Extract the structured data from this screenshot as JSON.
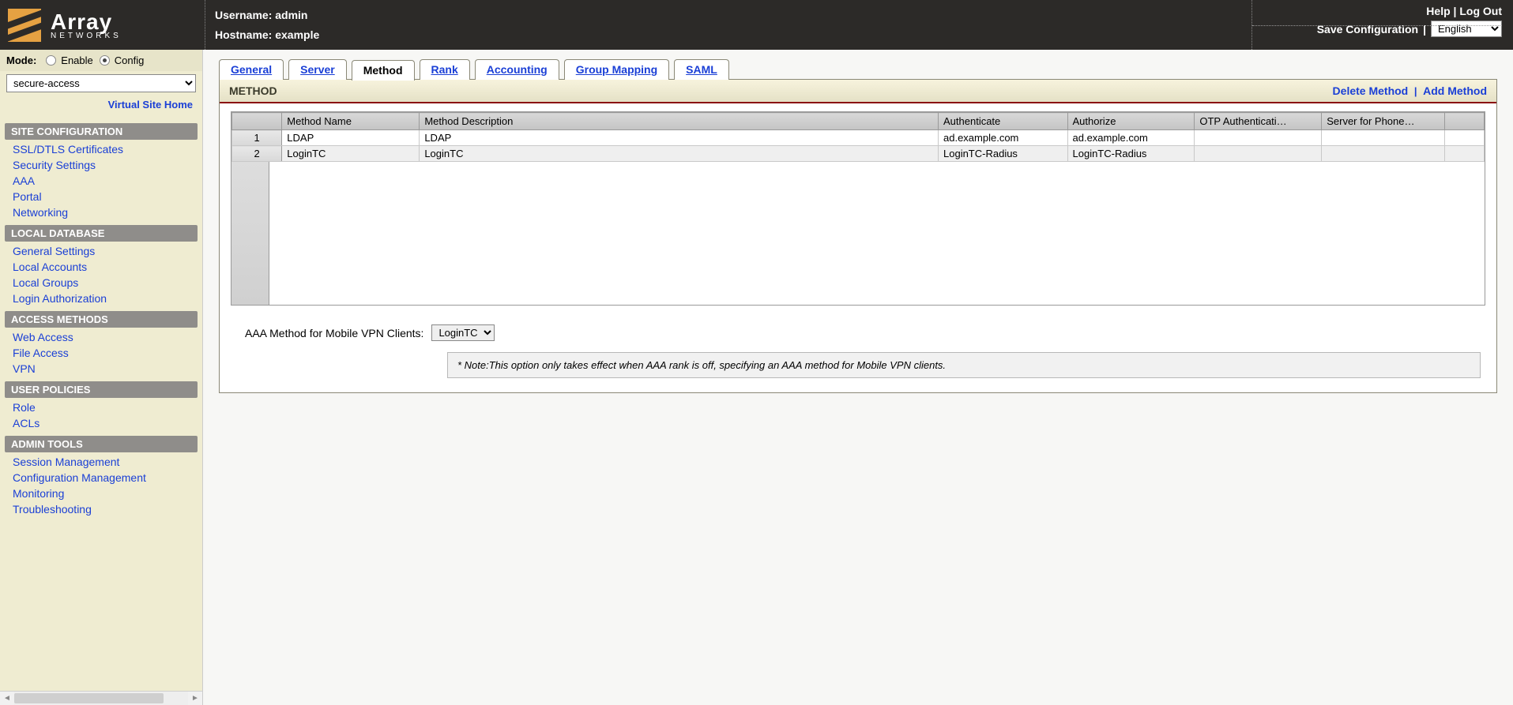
{
  "header": {
    "username_label": "Username: admin",
    "hostname_label": "Hostname: example",
    "help": "Help",
    "logout": "Log Out",
    "save_config": "Save Configuration",
    "language_selected": "English",
    "logo_big": "Array",
    "logo_small": "NETWORKS"
  },
  "sidebar": {
    "mode_label": "Mode:",
    "mode_enable": "Enable",
    "mode_config": "Config",
    "virtual_site_selected": "secure-access",
    "virtual_site_home": "Virtual Site Home",
    "sections": [
      {
        "title": "SITE CONFIGURATION",
        "items": [
          "SSL/DTLS Certificates",
          "Security Settings",
          "AAA",
          "Portal",
          "Networking"
        ]
      },
      {
        "title": "LOCAL DATABASE",
        "items": [
          "General Settings",
          "Local Accounts",
          "Local Groups",
          "Login Authorization"
        ]
      },
      {
        "title": "ACCESS METHODS",
        "items": [
          "Web Access",
          "File Access",
          "VPN"
        ]
      },
      {
        "title": "USER POLICIES",
        "items": [
          "Role",
          "ACLs"
        ]
      },
      {
        "title": "ADMIN TOOLS",
        "items": [
          "Session Management",
          "Configuration Management",
          "Monitoring",
          "Troubleshooting"
        ]
      }
    ]
  },
  "tabs": [
    "General",
    "Server",
    "Method",
    "Rank",
    "Accounting",
    "Group Mapping",
    "SAML"
  ],
  "active_tab": "Method",
  "panel": {
    "title": "METHOD",
    "delete_label": "Delete Method",
    "add_label": "Add Method",
    "columns": [
      "",
      "Method Name",
      "Method Description",
      "Authenticate",
      "Authorize",
      "OTP Authenticati…",
      "Server for Phone…",
      ""
    ],
    "rows": [
      {
        "num": "1",
        "name": "LDAP",
        "desc": "LDAP",
        "auth": "ad.example.com",
        "authz": "ad.example.com",
        "otp": "",
        "server": ""
      },
      {
        "num": "2",
        "name": "LoginTC",
        "desc": "LoginTC",
        "auth": "LoginTC-Radius",
        "authz": "LoginTC-Radius",
        "otp": "",
        "server": ""
      }
    ]
  },
  "mvpn": {
    "label": "AAA Method for Mobile VPN Clients:",
    "selected": "LoginTC",
    "note": "* Note:This option only takes effect when AAA rank is off, specifying an AAA method for Mobile VPN clients."
  }
}
